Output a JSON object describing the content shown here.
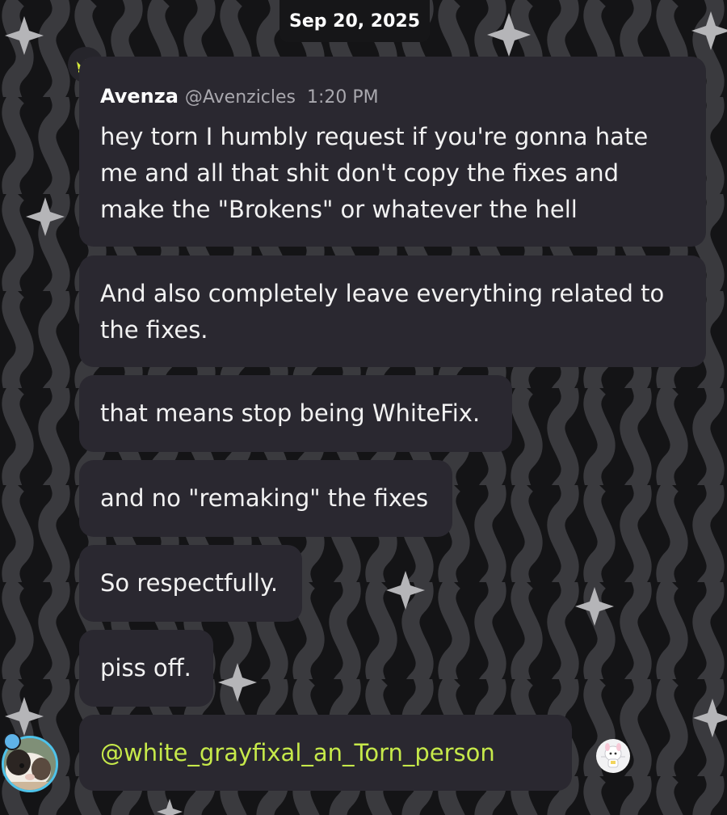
{
  "date_divider": "Sep 20, 2025",
  "message": {
    "author": "Avenza",
    "handle": "@Avenzicles",
    "time": "1:20 PM",
    "lines": [
      "hey torn I humbly request if you're gonna hate",
      "me and all that shit don't copy the fixes and",
      "make the \"Brokens\" or whatever the hell"
    ]
  },
  "followups": {
    "m1_l1": "And also completely leave everything related to",
    "m1_l2": "the fixes.",
    "m2": "that means stop being WhiteFix.",
    "m3": "and no \"remaking\" the fixes",
    "m4": "So respectfully.",
    "m5": "piss off.",
    "m6_mention": "@white_grayfixal_an_Torn_person"
  },
  "icons": {
    "crown": "crown-icon",
    "avatar": "guinea-pig-avatar",
    "sticker": "sticker-emoji"
  },
  "colors": {
    "background": "#1a1a1d",
    "bubble": "#2a2830",
    "mention": "#c6e94a",
    "crown": "#d7ec3b",
    "avatar_ring": "#4ec3ea"
  }
}
